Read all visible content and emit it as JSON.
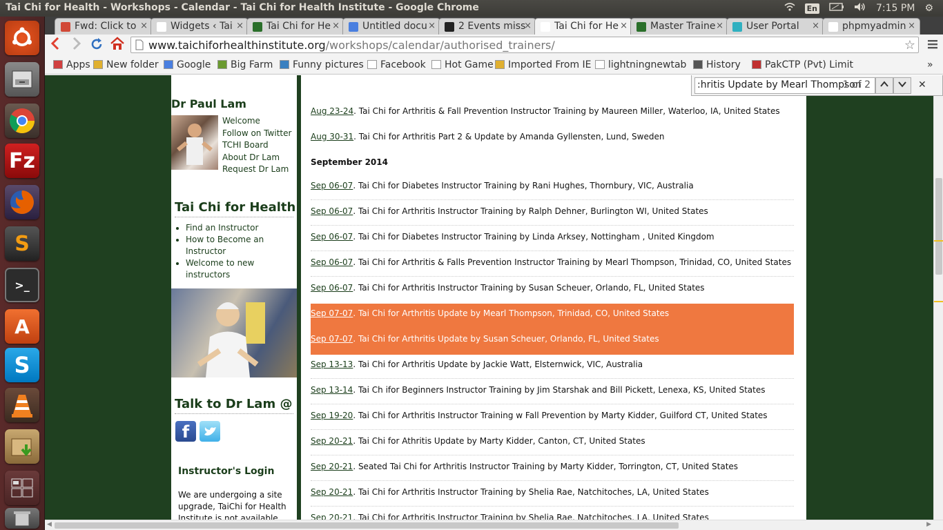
{
  "window_title": "Tai Chi for Health - Workshops - Calendar - Tai Chi for Health Institute - Google Chrome",
  "tray": {
    "keyboard": "En",
    "clock": "7:15 PM"
  },
  "tabs": [
    {
      "label": "Fwd: Click to",
      "color": "#d14836"
    },
    {
      "label": "Widgets ‹ Tai",
      "color": "#ffffff"
    },
    {
      "label": "Tai Chi for He",
      "color": "#2a6f2a"
    },
    {
      "label": "Untitled docu",
      "color": "#4a7fe0"
    },
    {
      "label": "2 Events miss",
      "color": "#222222"
    },
    {
      "label": "Tai Chi for He",
      "color": "#ffffff"
    },
    {
      "label": "Master Traine",
      "color": "#2a6f2a"
    },
    {
      "label": "User Portal",
      "color": "#30b0c0"
    },
    {
      "label": "phpmyadmin",
      "color": "#ffffff"
    }
  ],
  "url": {
    "host": "www.taichiforhealthinstitute.org",
    "path": "/workshops/calendar/authorised_trainers/"
  },
  "bookmarks": [
    "Apps",
    "New folder",
    "Google",
    "Big Farm",
    "Funny pictures",
    "Facebook",
    "Hot Game",
    "Imported From IE",
    "lightningnewtab",
    "History",
    "PakCTP (Pvt) Limit"
  ],
  "find": {
    "query": ":hritis Update by Mearl Thompson",
    "count": "1 of 2"
  },
  "sidebar": {
    "dr_heading": "Dr Paul Lam",
    "dr_links": [
      "Welcome",
      "Follow on Twitter",
      "TCHI Board",
      "About Dr Lam",
      "Request Dr Lam"
    ],
    "tch_heading": "Tai Chi for Health",
    "tch_links": [
      "Find an Instructor",
      "How to Become an Instructor",
      "Welcome to new instructors"
    ],
    "talk_heading": "Talk to Dr Lam @",
    "login_heading": "Instructor's Login",
    "login_text": "We are undergoing a site upgrade, TaiChi for Health Institute is not available right now. But please check back"
  },
  "events_top": [
    {
      "date": "Aug 23-24",
      "text": ". Tai Chi for Arthritis & Fall Prevention Instructor Training by Maureen Miller, Waterloo, IA, United States"
    },
    {
      "date": "Aug 30-31",
      "text": ". Tai Chi for Arthritis Part 2 & Update by Amanda Gyllensten, Lund, Sweden"
    }
  ],
  "month": "September 2014",
  "events": [
    {
      "date": "Sep 06-07",
      "text": ". Tai Chi for Diabetes Instructor Training by Rani Hughes, Thornbury, VIC, Australia"
    },
    {
      "date": "Sep 06-07",
      "text": ". Tai Chi for Arthritis Instructor Training by Ralph Dehner, Burlington WI, United States"
    },
    {
      "date": "Sep 06-07",
      "text": ". Tai Chi for Diabetes Instructor Training by Linda Arksey, Nottingham , United Kingdom"
    },
    {
      "date": "Sep 06-07",
      "text": ". Tai Chi for Arthritis & Falls Prevention Instructor Training by Mearl Thompson, Trinidad, CO, United States"
    },
    {
      "date": "Sep 06-07",
      "text": ". Tai Chi for Arthritis Instructor Training by Susan Scheuer, Orlando, FL, United States"
    },
    {
      "date": "Sep 07-07",
      "text": ". Tai Chi for Arthritis Update by Mearl Thompson, Trinidad, CO, United States",
      "highlight": true
    },
    {
      "date": "Sep 07-07",
      "text": ". Tai Chi for Arthritis Update by Susan Scheuer, Orlando, FL, United States",
      "highlight": true
    },
    {
      "date": "Sep 13-13",
      "text": ". Tai Chi for Arthritis Update by Jackie Watt, Elsternwick, VIC, Australia"
    },
    {
      "date": "Sep 13-14",
      "text": ". Tai Ch ifor Beginners Instructor Training by Jim Starshak and Bill Pickett, Lenexa, KS, United States"
    },
    {
      "date": "Sep 19-20",
      "text": ". Tai Chi for Arthritis Instructor Training w Fall Prevention by Marty Kidder, Guilford CT, United States"
    },
    {
      "date": "Sep 20-21",
      "text": ". Tai Chi for Athritis Update by Marty Kidder, Canton, CT, United States"
    },
    {
      "date": "Sep 20-21",
      "text": ". Seated Tai Chi for Arthritis Instructor Training by Marty Kidder, Torrington, CT, United States"
    },
    {
      "date": "Sep 20-21",
      "text": ". Tai Chi for Arthritis Instructor Training by Shelia Rae, Natchitoches, LA, United States"
    },
    {
      "date": "Sep 20-21",
      "text": ". Tai Chi for Arthritis Instructor Training by Shelia Rae, Natchitoches, LA, United States"
    }
  ],
  "colors": {
    "page_green": "#1f4020",
    "highlight": "#ef7840",
    "launcher": "#5a2a2a"
  }
}
